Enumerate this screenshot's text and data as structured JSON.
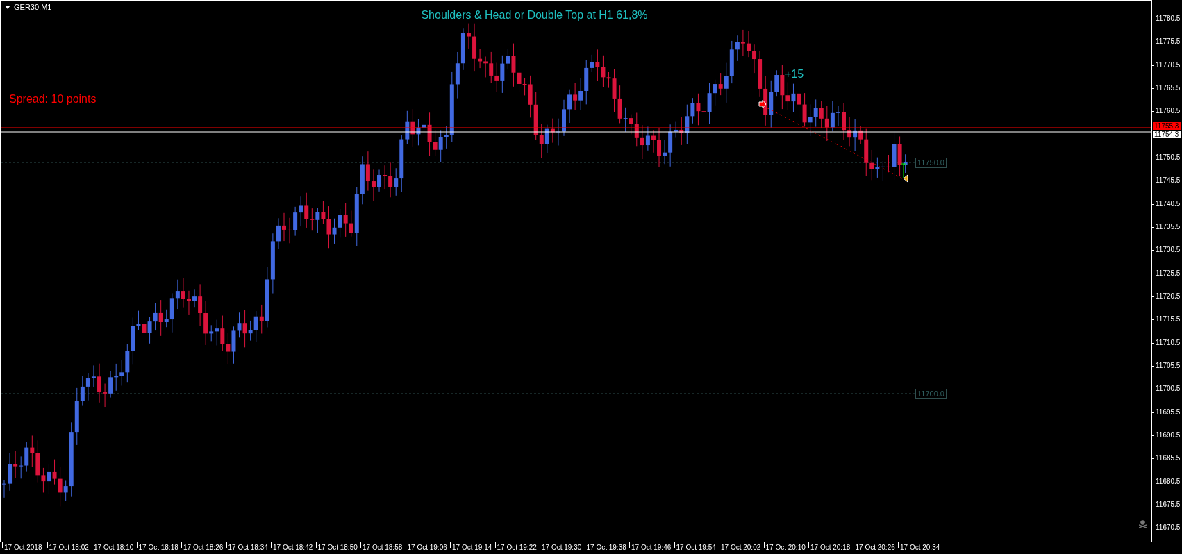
{
  "chart": {
    "symbol": "GER30,M1",
    "title": "Shoulders & Head or Double Top at H1 61,8%",
    "profit_label": "+15",
    "spread_label": "Spread: 10 points",
    "levels": [
      {
        "label": "11750.0"
      },
      {
        "label": "11700.0"
      }
    ],
    "ask_label": "11755.3",
    "bid_label": "11754.3"
  },
  "price_axis": [
    "11780.5",
    "11775.5",
    "11770.5",
    "11765.5",
    "11760.5",
    "11750.5",
    "11745.5",
    "11740.5",
    "11735.5",
    "11730.5",
    "11725.5",
    "11720.5",
    "11715.5",
    "11710.5",
    "11705.5",
    "11700.5",
    "11695.5",
    "11690.5",
    "11685.5",
    "11680.5",
    "11675.5",
    "11670.5"
  ],
  "time_axis": [
    "17 Oct 2018",
    "17 Oct 18:02",
    "17 Oct 18:10",
    "17 Oct 18:18",
    "17 Oct 18:26",
    "17 Oct 18:34",
    "17 Oct 18:42",
    "17 Oct 18:50",
    "17 Oct 18:58",
    "17 Oct 19:06",
    "17 Oct 19:14",
    "17 Oct 19:22",
    "17 Oct 19:30",
    "17 Oct 19:38",
    "17 Oct 19:46",
    "17 Oct 19:54",
    "17 Oct 20:02",
    "17 Oct 20:10",
    "17 Oct 20:18",
    "17 Oct 20:26",
    "17 Oct 20:34"
  ]
}
